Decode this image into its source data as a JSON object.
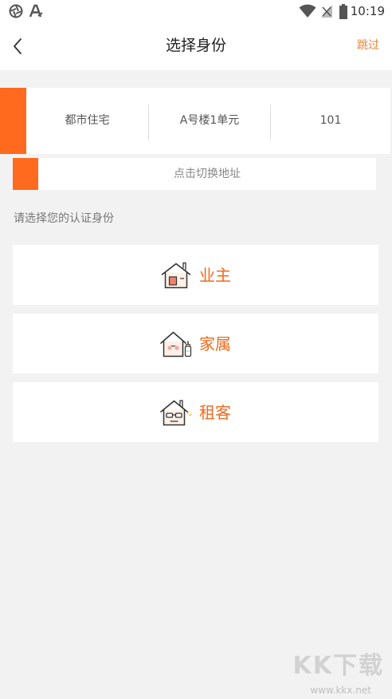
{
  "status_bar": {
    "time": "10:19",
    "left_icons": [
      "aperture-icon",
      "letter-a-icon"
    ],
    "right_icons": [
      "wifi-icon",
      "signal-off-icon",
      "battery-icon"
    ]
  },
  "header": {
    "back_icon": "chevron-left-icon",
    "title": "选择身份",
    "skip_label": "跳过"
  },
  "address": {
    "community": "都市住宅",
    "building": "A号楼1单元",
    "room": "101",
    "switch_label": "点击切换地址"
  },
  "identity": {
    "prompt": "请选择您的认证身份",
    "options": [
      {
        "label": "业主",
        "icon": "owner-house-icon"
      },
      {
        "label": "家属",
        "icon": "family-house-icon"
      },
      {
        "label": "租客",
        "icon": "tenant-house-icon"
      }
    ]
  },
  "colors": {
    "accent": "#ff6a1f",
    "label": "#f06a1e",
    "background": "#f2f2f2",
    "card": "#ffffff"
  },
  "watermark": {
    "brand": "KK下载",
    "url": "www.kkx.net"
  }
}
